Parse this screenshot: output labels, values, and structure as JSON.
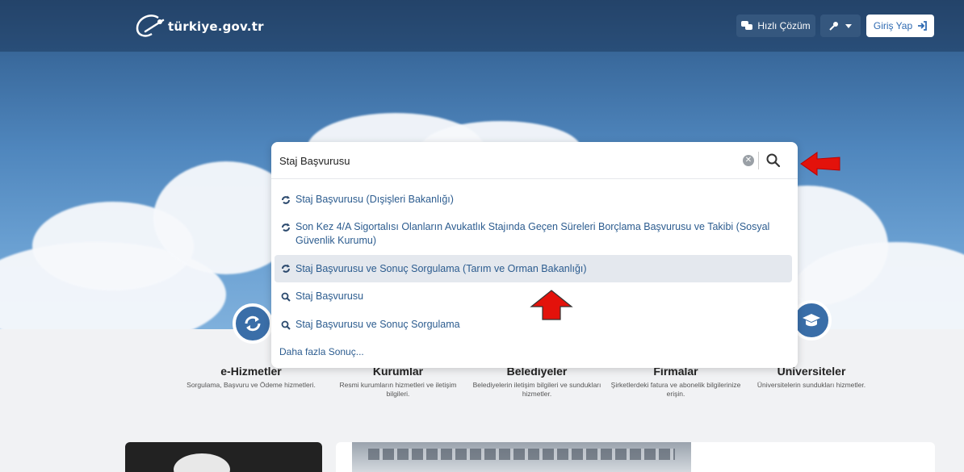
{
  "header": {
    "logo_text": "türkiye.gov.tr",
    "quick_solution_label": "Hızlı Çözüm",
    "login_label": "Giriş Yap"
  },
  "search": {
    "query": "Staj Başvurusu",
    "suggestions": [
      {
        "type": "service",
        "text": "Staj Başvurusu (Dışişleri Bakanlığı)"
      },
      {
        "type": "service",
        "text": "Son Kez 4/A Sigortalısı Olanların Avukatlık Stajında Geçen Süreleri Borçlama Başvurusu ve Takibi (Sosyal Güvenlik Kurumu)"
      },
      {
        "type": "service",
        "text": "Staj Başvurusu ve Sonuç Sorgulama (Tarım ve Orman Bakanlığı)",
        "highlighted": true
      },
      {
        "type": "search",
        "text": "Staj Başvurusu"
      },
      {
        "type": "search",
        "text": "Staj Başvurusu ve Sonuç Sorgulama"
      }
    ],
    "more_results_label": "Daha fazla Sonuç..."
  },
  "categories": [
    {
      "title": "e-Hizmetler",
      "desc": "Sorgulama, Başvuru ve Ödeme hizmetleri."
    },
    {
      "title": "Kurumlar",
      "desc": "Resmi kurumların hizmetleri ve iletişim bilgileri."
    },
    {
      "title": "Belediyeler",
      "desc": "Belediyelerin iletişim bilgileri ve sundukları hizmetler."
    },
    {
      "title": "Firmalar",
      "desc": "Şirketlerdeki fatura ve abonelik bilgilerinize erişin."
    },
    {
      "title": "Üniversiteler",
      "desc": "Üniversitelerin sundukları hizmetler."
    }
  ],
  "colors": {
    "accent": "#3a6ea8",
    "link": "#2c5c8f",
    "annotation_arrow": "#e3120b"
  },
  "icons": {
    "quick": "chat-bubbles-icon",
    "key": "key-icon",
    "login": "sign-in-icon",
    "service": "refresh-icon",
    "search": "search-icon"
  }
}
